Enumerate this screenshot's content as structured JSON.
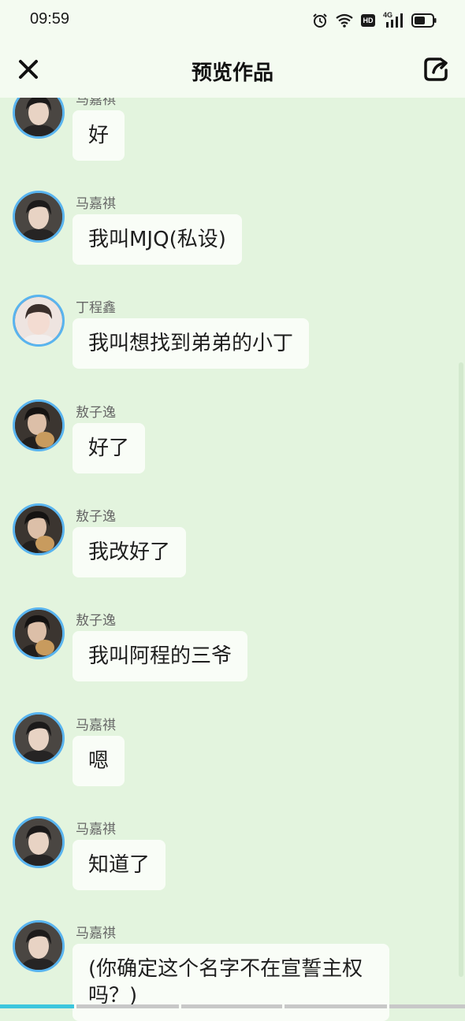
{
  "status_bar": {
    "time": "09:59",
    "icons": [
      "alarm-icon",
      "wifi-icon",
      "hd-icon",
      "signal-4g-icon",
      "battery-icon"
    ],
    "hd_label": "HD",
    "network_label": "4G"
  },
  "header": {
    "title": "预览作品",
    "close_icon": "close-icon",
    "share_icon": "share-icon"
  },
  "messages": [
    {
      "sender": "马嘉祺",
      "text": "好"
    },
    {
      "sender": "马嘉祺",
      "text": "我叫MJQ(私设)"
    },
    {
      "sender": "丁程鑫",
      "text": "我叫想找到弟弟的小丁"
    },
    {
      "sender": "敖子逸",
      "text": "好了"
    },
    {
      "sender": "敖子逸",
      "text": "我改好了"
    },
    {
      "sender": "敖子逸",
      "text": "我叫阿程的三爷"
    },
    {
      "sender": "马嘉祺",
      "text": "嗯"
    },
    {
      "sender": "马嘉祺",
      "text": "知道了"
    },
    {
      "sender": "马嘉祺",
      "text": "(你确定这个名字不在宣誓主权吗？)"
    }
  ],
  "colors": {
    "background": "#e3f4de",
    "header_background": "#f4fbf1",
    "bubble": "#f9fdf7",
    "avatar_ring": "#59b4ef",
    "progress_active": "#3cc6dd"
  },
  "progress": {
    "segments": 5,
    "active_segment": 1
  }
}
